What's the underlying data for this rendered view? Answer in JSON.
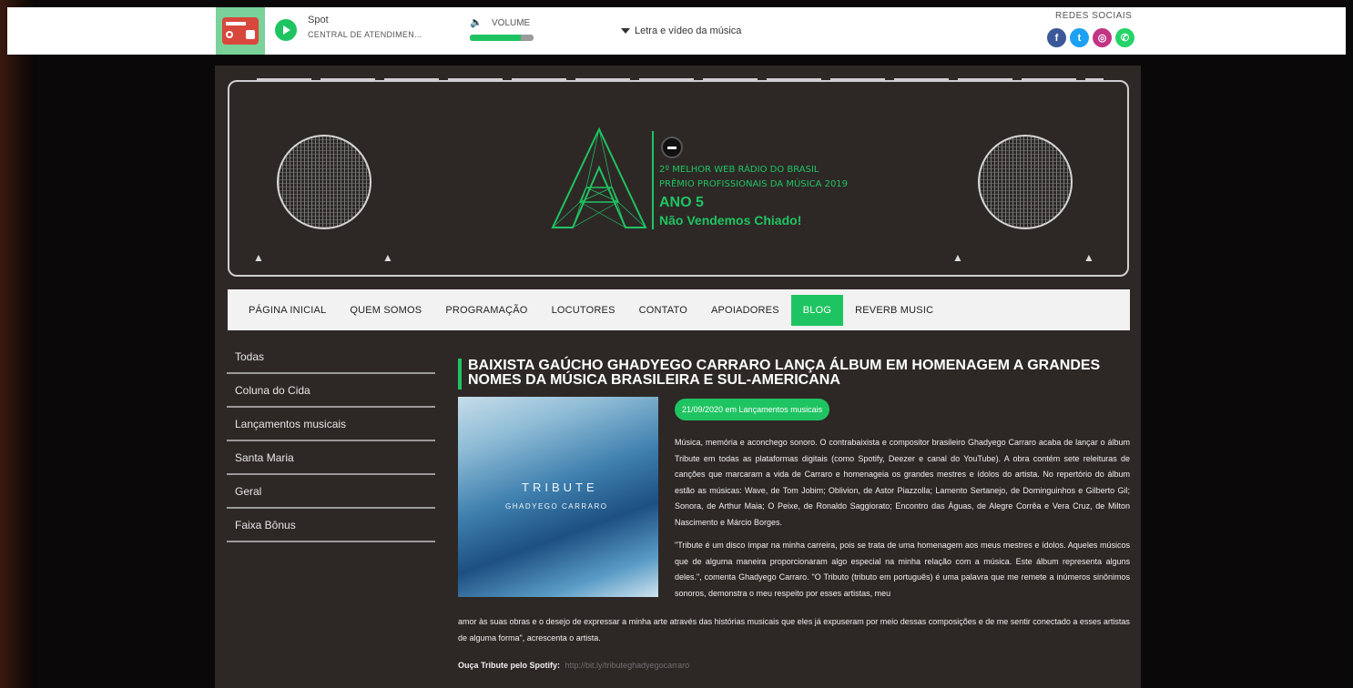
{
  "player": {
    "spot_label": "Spot",
    "spot_sub": "CENTRAL DE ATENDIMEN...",
    "volume_label": "VOLUME",
    "volume_level": 0.8,
    "lyrics_link": "Letra e vídeo da música"
  },
  "social": {
    "label": "REDES SOCIAIS",
    "icons": [
      {
        "name": "facebook-icon",
        "glyph": "f",
        "color": "#3b5998"
      },
      {
        "name": "twitter-icon",
        "glyph": "t",
        "color": "#1da1f2"
      },
      {
        "name": "instagram-icon",
        "glyph": "◎",
        "color": "#c13584"
      },
      {
        "name": "whatsapp-icon",
        "glyph": "✆",
        "color": "#25d366"
      }
    ]
  },
  "banner": {
    "logo_letter": "A",
    "line1": "2º MELHOR WEB RÁDIO DO BRASIL",
    "line2": "PRÊMIO PROFISSIONAIS DA MÚSICA 2019",
    "line3": "ANO 5",
    "line4": "Não Vendemos Chiado!"
  },
  "nav": [
    {
      "label": "PÁGINA INICIAL",
      "active": false
    },
    {
      "label": "QUEM SOMOS",
      "active": false
    },
    {
      "label": "PROGRAMAÇÃO",
      "active": false
    },
    {
      "label": "LOCUTORES",
      "active": false
    },
    {
      "label": "CONTATO",
      "active": false
    },
    {
      "label": "APOIADORES",
      "active": false
    },
    {
      "label": "BLOG",
      "active": true
    },
    {
      "label": "REVERB MUSIC",
      "active": false
    }
  ],
  "sidebar": {
    "items": [
      {
        "label": "Todas"
      },
      {
        "label": "Coluna do Cida"
      },
      {
        "label": "Lançamentos musicais"
      },
      {
        "label": "Santa Maria"
      },
      {
        "label": "Geral"
      },
      {
        "label": "Faixa Bônus"
      }
    ]
  },
  "article": {
    "title": "BAIXISTA GAÚCHO GHADYEGO CARRARO LANÇA ÁLBUM EM HOMENAGEM A GRANDES NOMES DA MÚSICA BRASILEIRA E SUL-AMERICANA",
    "date_badge": "21/09/2020 em Lançamentos musicais",
    "cover_title": "TRIBUTE",
    "cover_sub": "GHADYEGO CARRARO",
    "para1": "Música, memória e aconchego sonoro. O contrabaixista e compositor brasileiro Ghadyego Carraro acaba de lançar o álbum Tribute em todas as plataformas digitais (como Spotify, Deezer e canal do YouTube). A obra contém sete releituras de canções que marcaram a vida de Carraro e homenageia os grandes mestres e ídolos do artista. No repertório do álbum estão as músicas: Wave, de Tom Jobim; Oblivion, de Astor Piazzolla; Lamento Sertanejo, de Dominguinhos e Gilberto Gil; Sonora, de Arthur Maia; O Peixe, de Ronaldo Saggiorato; Encontro das Águas, de Alegre Corrêa e Vera Cruz, de Milton Nascimento e Márcio Borges.",
    "para2": "\"Tribute é um disco ímpar na minha carreira, pois se trata de uma homenagem aos meus mestres e ídolos. Aqueles músicos que de alguma maneira proporcionaram algo especial na minha relação com a música. Este álbum representa alguns deles.\", comenta Ghadyego Carraro. \"O Tributo (tributo em português) é uma palavra que me remete a inúmeros sinônimos sonoros, demonstra o meu respeito por esses artistas, meu",
    "para2_cont": "amor às suas obras e o desejo de expressar a minha arte através das histórias musicais que eles já expuseram por meio dessas composições e de me sentir conectado a esses artistas de alguma forma\", acrescenta o artista.",
    "listen_label": "Ouça Tribute pelo Spotify:",
    "listen_link": "http://bit.ly/tributeghadyegocarraro"
  }
}
